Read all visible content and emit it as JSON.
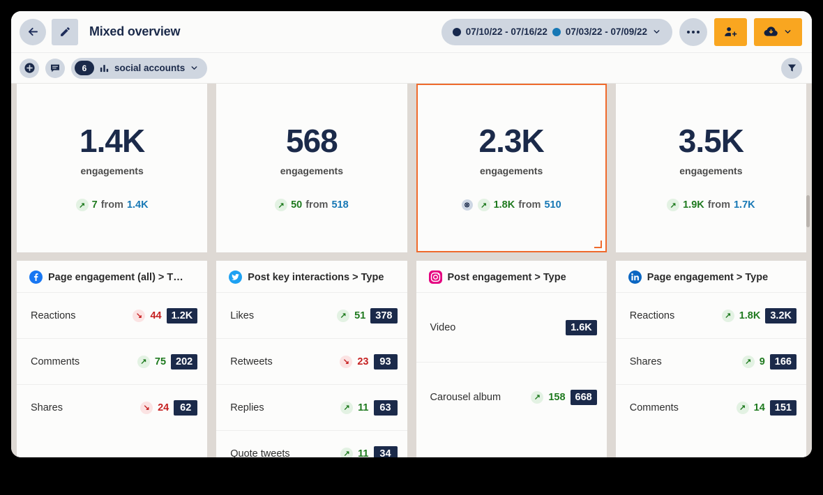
{
  "header": {
    "back_icon": "arrow-left-icon",
    "edit_icon": "pencil-icon",
    "title": "Mixed overview",
    "daterange": {
      "primary": "07/10/22 - 07/16/22",
      "comparison": "07/03/22 - 07/09/22",
      "primary_color": "#17284d",
      "comparison_color": "#1778b5",
      "chevron_icon": "chevron-down-icon"
    },
    "more_icon": "ellipsis-icon",
    "share_icon": "person-add-icon",
    "export_icon": "cloud-download-icon",
    "export_chevron_icon": "chevron-down-icon",
    "accent_orange": "#f9a620"
  },
  "toolbar": {
    "add_icon": "add-circle-icon",
    "comment_icon": "comment-icon",
    "accounts_count": "6",
    "accounts_chart_icon": "bar-chart-icon",
    "accounts_label": "social accounts",
    "accounts_chevron_icon": "chevron-down-icon",
    "filter_icon": "funnel-filter-icon"
  },
  "kpi_cards": [
    {
      "value": "1.4K",
      "label": "engagements",
      "delta_direction": "up",
      "delta": "7",
      "from_label": "from",
      "previous": "1.4K",
      "selected": false,
      "has_dot_badge": false
    },
    {
      "value": "568",
      "label": "engagements",
      "delta_direction": "up",
      "delta": "50",
      "from_label": "from",
      "previous": "518",
      "selected": false,
      "has_dot_badge": false
    },
    {
      "value": "2.3K",
      "label": "engagements",
      "delta_direction": "up",
      "delta": "1.8K",
      "from_label": "from",
      "previous": "510",
      "selected": true,
      "has_dot_badge": true
    },
    {
      "value": "3.5K",
      "label": "engagements",
      "delta_direction": "up",
      "delta": "1.9K",
      "from_label": "from",
      "previous": "1.7K",
      "selected": false,
      "has_dot_badge": false
    }
  ],
  "table_cards": [
    {
      "network": "facebook",
      "network_icon": "facebook-icon",
      "title": "Page engagement (all) > T…",
      "rows": [
        {
          "label": "Reactions",
          "delta_direction": "down",
          "delta": "44",
          "value": "1.2K",
          "tall": false
        },
        {
          "label": "Comments",
          "delta_direction": "up",
          "delta": "75",
          "value": "202",
          "tall": false
        },
        {
          "label": "Shares",
          "delta_direction": "down",
          "delta": "24",
          "value": "62",
          "tall": false
        }
      ]
    },
    {
      "network": "twitter",
      "network_icon": "twitter-icon",
      "title": "Post key interactions > Type",
      "rows": [
        {
          "label": "Likes",
          "delta_direction": "up",
          "delta": "51",
          "value": "378",
          "tall": false
        },
        {
          "label": "Retweets",
          "delta_direction": "down",
          "delta": "23",
          "value": "93",
          "tall": false
        },
        {
          "label": "Replies",
          "delta_direction": "up",
          "delta": "11",
          "value": "63",
          "tall": false
        },
        {
          "label": "Quote tweets",
          "delta_direction": "up",
          "delta": "11",
          "value": "34",
          "tall": false
        }
      ]
    },
    {
      "network": "instagram",
      "network_icon": "instagram-icon",
      "title": "Post engagement > Type",
      "rows": [
        {
          "label": "Video",
          "delta_direction": "none",
          "delta": "",
          "value": "1.6K",
          "tall": true
        },
        {
          "label": "Carousel album",
          "delta_direction": "up",
          "delta": "158",
          "value": "668",
          "tall": true
        }
      ]
    },
    {
      "network": "linkedin",
      "network_icon": "linkedin-icon",
      "title": "Page engagement > Type",
      "rows": [
        {
          "label": "Reactions",
          "delta_direction": "up",
          "delta": "1.8K",
          "value": "3.2K",
          "tall": false
        },
        {
          "label": "Shares",
          "delta_direction": "up",
          "delta": "9",
          "value": "166",
          "tall": false
        },
        {
          "label": "Comments",
          "delta_direction": "up",
          "delta": "14",
          "value": "151",
          "tall": false
        }
      ]
    }
  ],
  "colors": {
    "navy": "#1b2a4a",
    "up_green": "#1f7a1f",
    "down_red": "#c62222",
    "link_blue": "#1778b5",
    "selection_orange": "#ef6a2c",
    "canvas_bg": "#ded9d4"
  }
}
